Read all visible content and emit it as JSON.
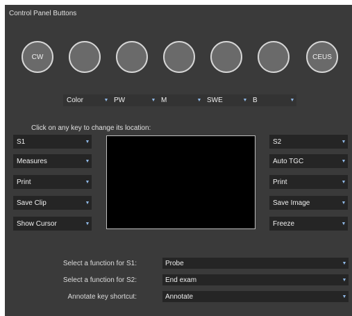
{
  "panel": {
    "title": "Control Panel Buttons",
    "instructions": "Click on any key to change its location:"
  },
  "knobs": [
    "CW",
    "",
    "",
    "",
    "",
    "",
    "CEUS"
  ],
  "mode_selects": [
    "Color",
    "PW",
    "M",
    "SWE",
    "B"
  ],
  "left_keys": [
    "S1",
    "Measures",
    "Print",
    "Save Clip",
    "Show Cursor"
  ],
  "right_keys": [
    "S2",
    "Auto TGC",
    "Print",
    "Save Image",
    "Freeze"
  ],
  "functions": [
    {
      "label": "Select a function for S1:",
      "value": "Probe"
    },
    {
      "label": "Select a function for S2:",
      "value": "End exam"
    },
    {
      "label": "Annotate key shortcut:",
      "value": "Annotate"
    }
  ],
  "caret_glyph": "▼"
}
